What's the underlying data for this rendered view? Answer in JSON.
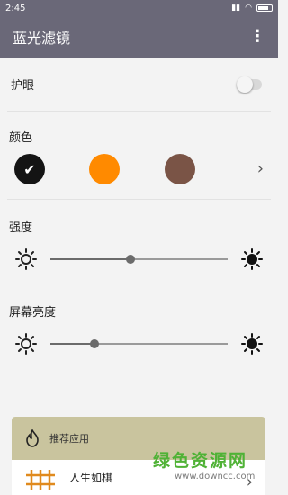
{
  "status_bar": {
    "time": "2:45"
  },
  "app_bar": {
    "title": "蓝光滤镜",
    "more_icon": "more-vert-icon"
  },
  "eye_protection": {
    "label": "护眼",
    "enabled": false
  },
  "color": {
    "label": "颜色",
    "swatches": [
      {
        "color": "#141414",
        "selected": true
      },
      {
        "color": "#ff8a00",
        "selected": false
      },
      {
        "color": "#7a5446",
        "selected": false
      }
    ]
  },
  "intensity": {
    "label": "强度",
    "value": 0.45
  },
  "brightness": {
    "label": "屏幕亮度",
    "value": 0.25
  },
  "recommend": {
    "title": "推荐应用",
    "app_name": "人生如棋"
  },
  "watermark": {
    "text": "绿色资源网",
    "url": "www.downcc.com"
  }
}
